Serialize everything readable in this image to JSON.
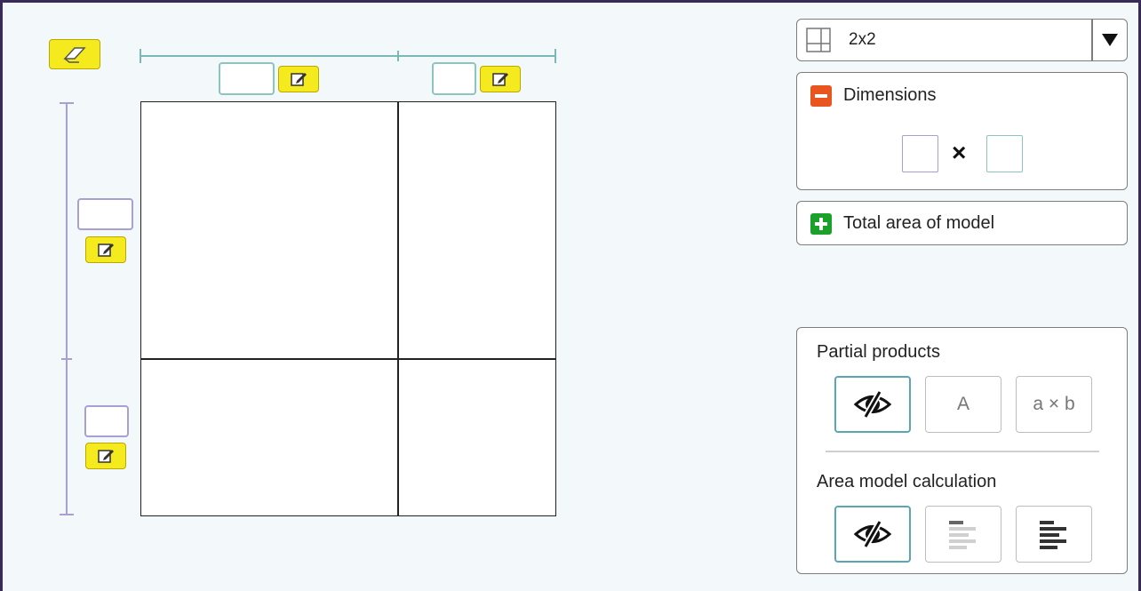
{
  "grid_select": {
    "value": "2x2"
  },
  "dimensions": {
    "label": "Dimensions",
    "times": "×"
  },
  "total_area": {
    "label": "Total area of model"
  },
  "partial_products": {
    "label": "Partial products",
    "option_a": "A",
    "option_ab": "a × b"
  },
  "area_calc": {
    "label": "Area model calculation"
  },
  "colors": {
    "accent": "#5aa6b2",
    "yellow": "#f5ea1e",
    "minus": "#e8551f",
    "plus": "#1aa12a"
  }
}
